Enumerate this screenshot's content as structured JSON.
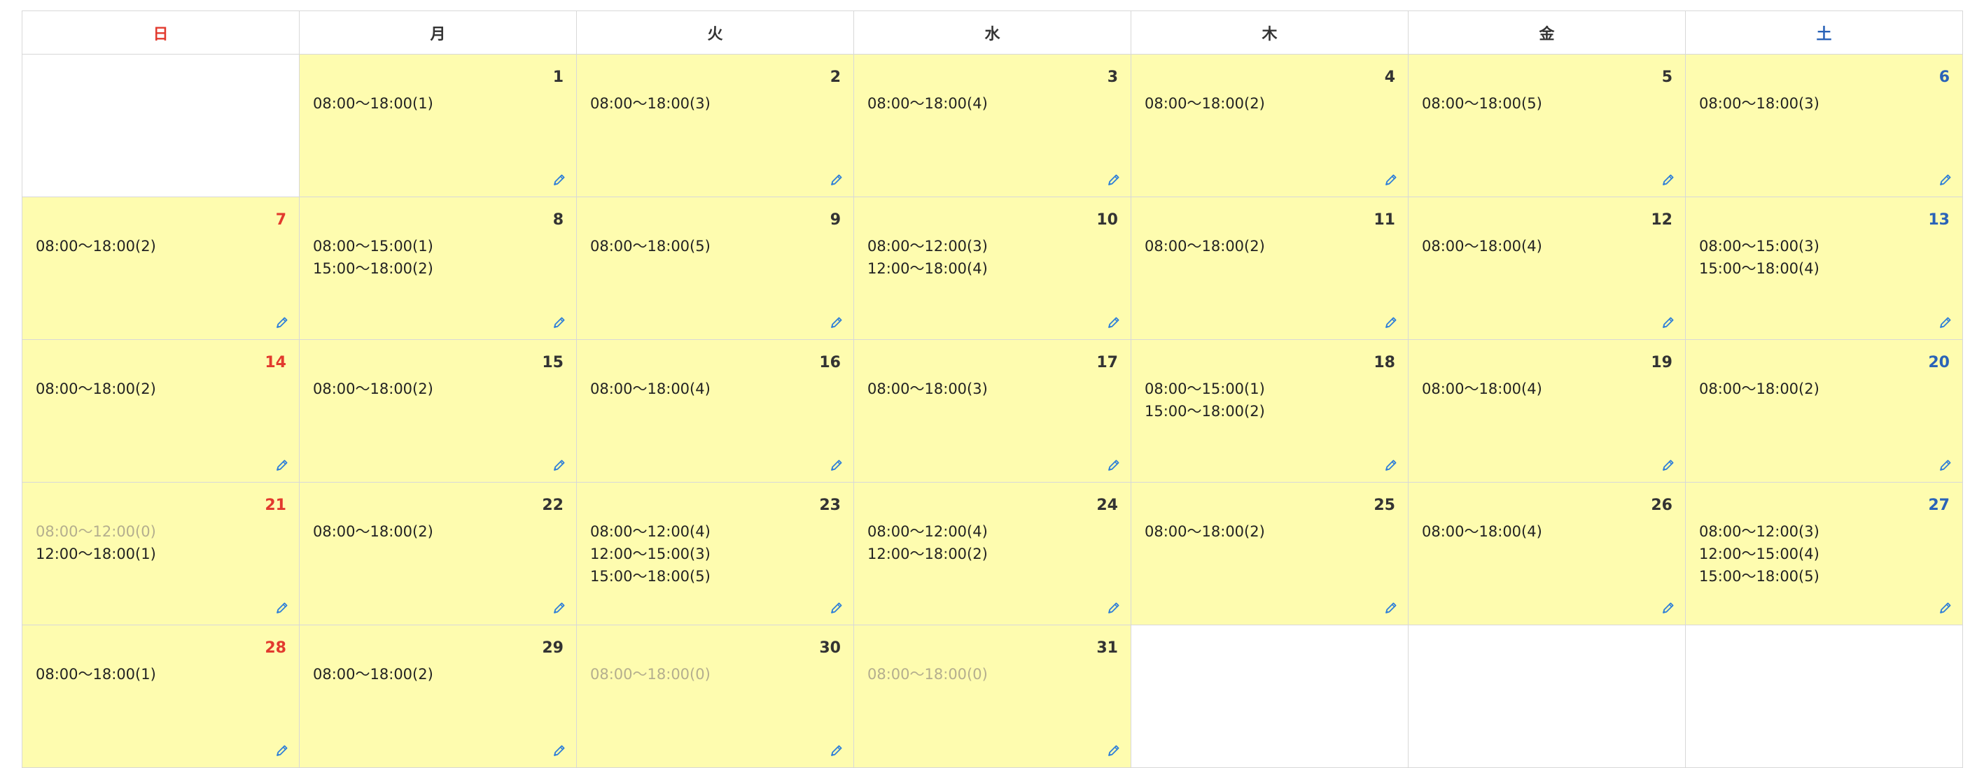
{
  "weekdays": [
    {
      "label": "日",
      "type": "sun"
    },
    {
      "label": "月",
      "type": "normal"
    },
    {
      "label": "火",
      "type": "normal"
    },
    {
      "label": "水",
      "type": "normal"
    },
    {
      "label": "木",
      "type": "normal"
    },
    {
      "label": "金",
      "type": "normal"
    },
    {
      "label": "土",
      "type": "sat"
    }
  ],
  "colors": {
    "cell_active": "#fefcaf",
    "sunday": "#e23a2e",
    "saturday": "#2a63b8",
    "empty_slot": "#b4ae8e",
    "edit_icon": "#2f7fd8"
  },
  "icons": {
    "edit": "pencil-icon"
  },
  "weeks": [
    [
      null,
      {
        "day": "1",
        "slots": [
          {
            "text": "08:00〜18:00(1)",
            "empty": false
          }
        ]
      },
      {
        "day": "2",
        "slots": [
          {
            "text": "08:00〜18:00(3)",
            "empty": false
          }
        ]
      },
      {
        "day": "3",
        "slots": [
          {
            "text": "08:00〜18:00(4)",
            "empty": false
          }
        ]
      },
      {
        "day": "4",
        "slots": [
          {
            "text": "08:00〜18:00(2)",
            "empty": false
          }
        ]
      },
      {
        "day": "5",
        "slots": [
          {
            "text": "08:00〜18:00(5)",
            "empty": false
          }
        ]
      },
      {
        "day": "6",
        "slots": [
          {
            "text": "08:00〜18:00(3)",
            "empty": false
          }
        ]
      }
    ],
    [
      {
        "day": "7",
        "slots": [
          {
            "text": "08:00〜18:00(2)",
            "empty": false
          }
        ]
      },
      {
        "day": "8",
        "slots": [
          {
            "text": "08:00〜15:00(1)",
            "empty": false
          },
          {
            "text": "15:00〜18:00(2)",
            "empty": false
          }
        ]
      },
      {
        "day": "9",
        "slots": [
          {
            "text": "08:00〜18:00(5)",
            "empty": false
          }
        ]
      },
      {
        "day": "10",
        "slots": [
          {
            "text": "08:00〜12:00(3)",
            "empty": false
          },
          {
            "text": "12:00〜18:00(4)",
            "empty": false
          }
        ]
      },
      {
        "day": "11",
        "slots": [
          {
            "text": "08:00〜18:00(2)",
            "empty": false
          }
        ]
      },
      {
        "day": "12",
        "slots": [
          {
            "text": "08:00〜18:00(4)",
            "empty": false
          }
        ]
      },
      {
        "day": "13",
        "slots": [
          {
            "text": "08:00〜15:00(3)",
            "empty": false
          },
          {
            "text": "15:00〜18:00(4)",
            "empty": false
          }
        ]
      }
    ],
    [
      {
        "day": "14",
        "slots": [
          {
            "text": "08:00〜18:00(2)",
            "empty": false
          }
        ]
      },
      {
        "day": "15",
        "slots": [
          {
            "text": "08:00〜18:00(2)",
            "empty": false
          }
        ]
      },
      {
        "day": "16",
        "slots": [
          {
            "text": "08:00〜18:00(4)",
            "empty": false
          }
        ]
      },
      {
        "day": "17",
        "slots": [
          {
            "text": "08:00〜18:00(3)",
            "empty": false
          }
        ]
      },
      {
        "day": "18",
        "slots": [
          {
            "text": "08:00〜15:00(1)",
            "empty": false
          },
          {
            "text": "15:00〜18:00(2)",
            "empty": false
          }
        ]
      },
      {
        "day": "19",
        "slots": [
          {
            "text": "08:00〜18:00(4)",
            "empty": false
          }
        ]
      },
      {
        "day": "20",
        "slots": [
          {
            "text": "08:00〜18:00(2)",
            "empty": false
          }
        ]
      }
    ],
    [
      {
        "day": "21",
        "slots": [
          {
            "text": "08:00〜12:00(0)",
            "empty": true
          },
          {
            "text": "12:00〜18:00(1)",
            "empty": false
          }
        ]
      },
      {
        "day": "22",
        "slots": [
          {
            "text": "08:00〜18:00(2)",
            "empty": false
          }
        ]
      },
      {
        "day": "23",
        "slots": [
          {
            "text": "08:00〜12:00(4)",
            "empty": false
          },
          {
            "text": "12:00〜15:00(3)",
            "empty": false
          },
          {
            "text": "15:00〜18:00(5)",
            "empty": false
          }
        ]
      },
      {
        "day": "24",
        "slots": [
          {
            "text": "08:00〜12:00(4)",
            "empty": false
          },
          {
            "text": "12:00〜18:00(2)",
            "empty": false
          }
        ]
      },
      {
        "day": "25",
        "slots": [
          {
            "text": "08:00〜18:00(2)",
            "empty": false
          }
        ]
      },
      {
        "day": "26",
        "slots": [
          {
            "text": "08:00〜18:00(4)",
            "empty": false
          }
        ]
      },
      {
        "day": "27",
        "slots": [
          {
            "text": "08:00〜12:00(3)",
            "empty": false
          },
          {
            "text": "12:00〜15:00(4)",
            "empty": false
          },
          {
            "text": "15:00〜18:00(5)",
            "empty": false
          }
        ]
      }
    ],
    [
      {
        "day": "28",
        "slots": [
          {
            "text": "08:00〜18:00(1)",
            "empty": false
          }
        ]
      },
      {
        "day": "29",
        "slots": [
          {
            "text": "08:00〜18:00(2)",
            "empty": false
          }
        ]
      },
      {
        "day": "30",
        "slots": [
          {
            "text": "08:00〜18:00(0)",
            "empty": true
          }
        ]
      },
      {
        "day": "31",
        "slots": [
          {
            "text": "08:00〜18:00(0)",
            "empty": true
          }
        ]
      },
      null,
      null,
      null
    ]
  ]
}
